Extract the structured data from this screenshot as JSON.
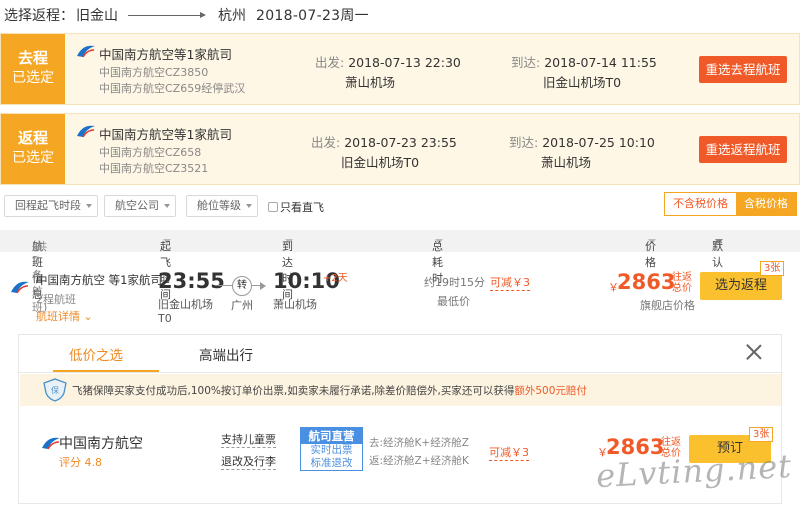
{
  "header": {
    "prefix": "选择返程：",
    "from_city": "旧金山",
    "to_city": "杭州",
    "date": "2018-07-23周一"
  },
  "selected_flights": [
    {
      "tag_line1": "去程",
      "tag_line2": "已选定",
      "airline": "中国南方航空等1家航司",
      "sub1": "中国南方航空CZ3850",
      "sub2": "中国南方航空CZ659经停武汉",
      "dep_label": "出发:",
      "dep_time": "2018-07-13 22:30",
      "dep_airport": "萧山机场",
      "arr_label": "到达:",
      "arr_time": "2018-07-14 11:55",
      "arr_airport": "旧金山机场T0",
      "button": "重选去程航班"
    },
    {
      "tag_line1": "返程",
      "tag_line2": "已选定",
      "airline": "中国南方航空等1家航司",
      "sub1": "中国南方航空CZ658",
      "sub2": "中国南方航空CZ3521",
      "dep_label": "出发:",
      "dep_time": "2018-07-23 23:55",
      "dep_airport": "旧金山机场T0",
      "arr_label": "到达:",
      "arr_time": "2018-07-25 10:10",
      "arr_airport": "萧山机场",
      "button": "重选返程航班"
    }
  ],
  "filters": {
    "dropdowns": [
      "回程起飞时段",
      "航空公司",
      "舱位等级"
    ],
    "direct_only": "只看直飞",
    "tax_excluded": "不含税价格",
    "tax_included": "含税价格"
  },
  "list_header": {
    "info": "航班信息",
    "count": "(共2条航班)",
    "dep_time": "起飞时间",
    "arr_time": "到达时间",
    "duration": "总耗时",
    "price": "价格",
    "sort": "默认排序"
  },
  "flight": {
    "airline": "中国南方航空 等1家航司",
    "legs": "2程航班",
    "detail": "航班详情",
    "dep_time": "23:55",
    "dep_airport": "旧金山机场",
    "dep_terminal": "T0",
    "transfer": "转",
    "transfer_city": "广州",
    "arr_time": "10:10",
    "plus_day": "+2天",
    "arr_airport": "萧山机场",
    "duration": "约19时15分",
    "lowest": "最低价",
    "discount": "可减￥3",
    "currency": "￥",
    "price": "2863",
    "price_note1": "往返",
    "price_note2": "总价",
    "store_price": "旗舰店价格",
    "button": "选为返程",
    "count_tag": "3张"
  },
  "panel": {
    "tab_low": "低价之选",
    "tab_high": "高端出行",
    "guarantee_text": "飞猪保障买家支付成功后,100%按订单价出票,如卖家未履行承诺,除差价赔偿外,买家还可以获得",
    "guarantee_highlight": "额外500元赔付",
    "offer": {
      "airline": "中国南方航空",
      "rating": "评分 4.8",
      "feature1": "支持儿童票",
      "feature2": "退改及行李",
      "badge_top": "航司直营",
      "badge_line1": "实时出票",
      "badge_line2": "标准退改",
      "cabin_go": "去:经济舱K+经济舱Z",
      "cabin_back": "返:经济舱Z+经济舱K",
      "discount": "可减￥3",
      "currency": "￥",
      "price": "2863",
      "price_note1": "往返",
      "price_note2": "总价",
      "button": "预订",
      "count_tag": "3张"
    }
  },
  "watermark": "eLvting.net",
  "colors": {
    "accent_orange": "#f5a623",
    "action_red": "#f05a28",
    "book_yellow": "#fbc02d",
    "airline_blue": "#1a73c8"
  }
}
